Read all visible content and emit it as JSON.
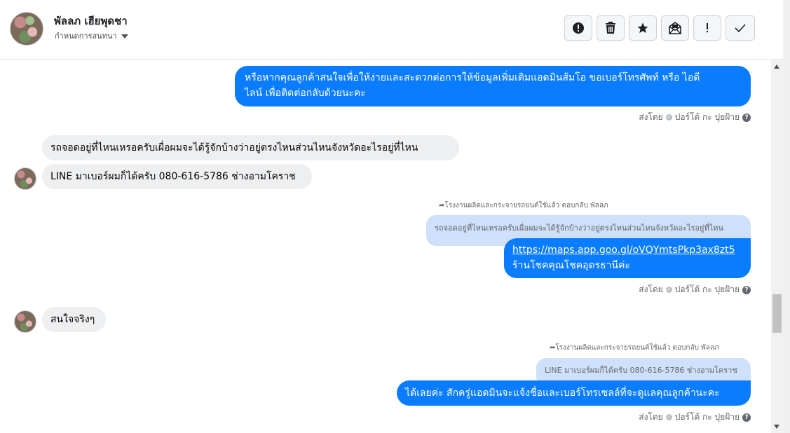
{
  "header": {
    "contact_name": "พัลลภ เฮียพุดชา",
    "assign_label": "กำหนดการสนทนา",
    "actions": [
      "mark-spam",
      "delete",
      "star",
      "mark-unread",
      "follow-up",
      "done"
    ]
  },
  "messages": {
    "m1": {
      "text_line1": "หรือหากคุณลูกค้าสนใจเพื่อให้ง่ายและสะดวกต่อการให้ข้อมูลเพิ่มเติมแอดมินส้มโอ ขอเบอร์โทรศัพท์ หรือ ไอดี",
      "text_line2": "ไลน์ เพื่อติดต่อกลับด้วยนะคะ"
    },
    "sent1": {
      "prefix": "ส่งโดย",
      "agent": "ปอร์โต้ กะ ปุยฝ้าย"
    },
    "m2": {
      "text": "รถจอดอยู่ที่ไหนเหรอครับเผื่อผมจะได้รู้จักบ้างว่าอยู่ตรงไหนส่วนไหนจังหวัดอะไรอยู่ที่ไหน"
    },
    "m3": {
      "text": "LINE มาเบอร์ผมก็ได้ครับ 080-616-5786 ช่างอามโคราช"
    },
    "reply1": {
      "note": "โรงงานผลิตและกระจายรถยนต์ใช้แล้ว ตอบกลับ พัลลภ",
      "quote": "รถจอดอยู่ที่ไหนเหรอครับเผื่อผมจะได้รู้จักบ้างว่าอยู่ตรงไหนส่วนไหนจังหวัดอะไรอยู่ที่ไหน",
      "link": "https://maps.app.goo.gl/oVQYmtsPkp3ax8zt5",
      "text": "ร้านโชคคุณโชคอุดรธานีค่ะ"
    },
    "sent2": {
      "prefix": "ส่งโดย",
      "agent": "ปอร์โต้ กะ ปุยฝ้าย"
    },
    "m4": {
      "text": "สนใจจริงๆ"
    },
    "reply2": {
      "note": "โรงงานผลิตและกระจายรถยนต์ใช้แล้ว ตอบกลับ พัลลภ",
      "quote": "LINE มาเบอร์ผมก็ได้ครับ 080-616-5786 ช่างอามโคราช",
      "text": "ได้เลยค่ะ สักครู่แอดมินจะแจ้งชื่อและเบอร์โทรเซลล์ที่จะดูแลคุณลูกค้านะคะ"
    },
    "sent3": {
      "prefix": "ส่งโดย",
      "agent": "ปอร์โต้ กะ ปุยฝ้าย"
    }
  },
  "colors": {
    "outgoing_bubble": "#0a7cff",
    "incoming_bubble": "#eeeff1",
    "quote_bubble": "#cfe0fa"
  }
}
